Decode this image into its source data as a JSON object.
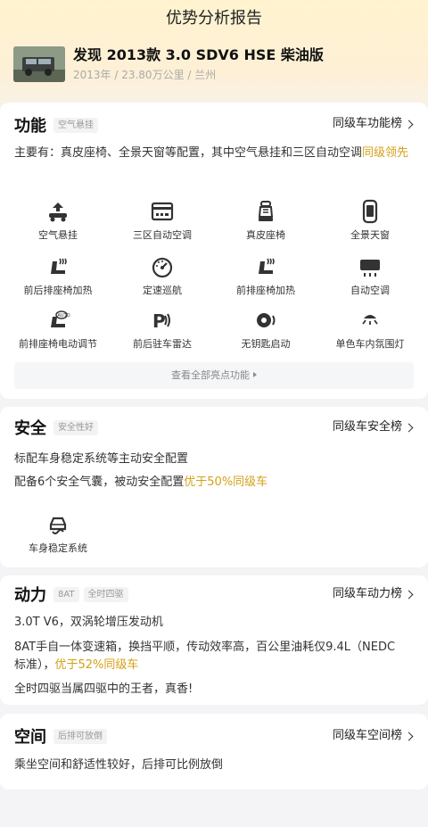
{
  "page": {
    "title": "优势分析报告"
  },
  "car": {
    "name": "发现 2013款 3.0 SDV6 HSE 柴油版",
    "meta": "2013年 / 23.80万公里 / 兰州"
  },
  "colors": {
    "accent": "#d4a017",
    "hero_top": "#fff3cf"
  },
  "function": {
    "title": "功能",
    "tag": "空气悬挂",
    "rank_link": "同级车功能榜",
    "summary_prefix": "主要有：真皮座椅、全景天窗等配置，其中空气悬挂和三区自动空调",
    "summary_highlight": "同级领先",
    "features": [
      {
        "label": "空气悬挂",
        "icon": "air-suspension-icon"
      },
      {
        "label": "三区自动空调",
        "icon": "tri-zone-ac-icon"
      },
      {
        "label": "真皮座椅",
        "icon": "leather-seat-icon"
      },
      {
        "label": "全景天窗",
        "icon": "panoramic-sunroof-icon"
      },
      {
        "label": "前后排座椅加热",
        "icon": "seat-heating-icon"
      },
      {
        "label": "定速巡航",
        "icon": "cruise-control-icon"
      },
      {
        "label": "前排座椅加热",
        "icon": "seat-heating-icon"
      },
      {
        "label": "自动空调",
        "icon": "auto-ac-icon"
      },
      {
        "label": "前排座椅电动调节",
        "icon": "power-seat-icon"
      },
      {
        "label": "前后驻车雷达",
        "icon": "parking-radar-icon"
      },
      {
        "label": "无钥匙启动",
        "icon": "keyless-start-icon"
      },
      {
        "label": "单色车内氛围灯",
        "icon": "ambient-light-icon"
      }
    ],
    "view_all": "查看全部亮点功能"
  },
  "safety": {
    "title": "安全",
    "tag": "安全性好",
    "rank_link": "同级车安全榜",
    "line1": "标配车身稳定系统等主动安全配置",
    "line2_prefix": "配备6个安全气囊，被动安全配置",
    "line2_highlight": "优于50%同级车",
    "feature": {
      "label": "车身稳定系统",
      "icon": "stability-control-icon"
    }
  },
  "power": {
    "title": "动力",
    "tags": [
      "8AT",
      "全时四驱"
    ],
    "rank_link": "同级车动力榜",
    "line1": "3.0T V6，双涡轮增压发动机",
    "line2": "8AT手自一体变速箱，换挡平顺，传动效率高，百公里油耗仅9.4L（NEDC",
    "line3_prefix": "标准），",
    "line3_highlight": "优于52%同级车",
    "line4": "全时四驱当属四驱中的王者，真香!"
  },
  "space": {
    "title": "空间",
    "tag": "后排可放倒",
    "rank_link": "同级车空间榜",
    "line1": "乘坐空间和舒适性较好，后排可比例放倒"
  }
}
